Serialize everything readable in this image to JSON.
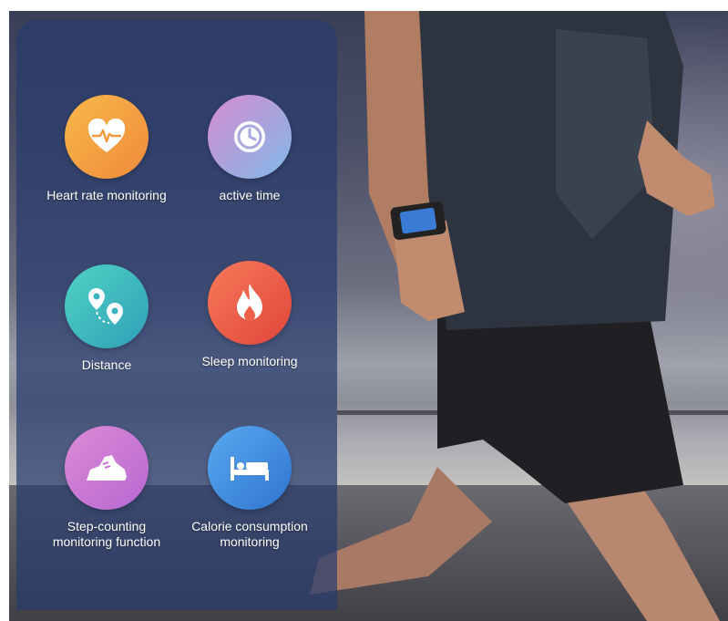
{
  "features": [
    {
      "label": "Heart rate monitoring",
      "icon": "heart-pulse-icon",
      "colors": [
        "#f7b84a",
        "#f08a3a"
      ]
    },
    {
      "label": "active time",
      "icon": "clock-icon",
      "colors": [
        "#d78bd0",
        "#7fb9e8"
      ]
    },
    {
      "label": "Distance",
      "icon": "location-pins-icon",
      "colors": [
        "#4fd3c4",
        "#2f9fb8"
      ]
    },
    {
      "label": "Sleep monitoring",
      "icon": "flame-icon",
      "colors": [
        "#f77a5a",
        "#e0453a"
      ]
    },
    {
      "label": "Step-counting\nmonitoring function",
      "icon": "sneaker-icon",
      "colors": [
        "#dc8ad6",
        "#b768d1"
      ]
    },
    {
      "label": "Calorie consumption\nmonitoring",
      "icon": "bed-icon",
      "colors": [
        "#5aa9f0",
        "#2f74d0"
      ]
    }
  ]
}
